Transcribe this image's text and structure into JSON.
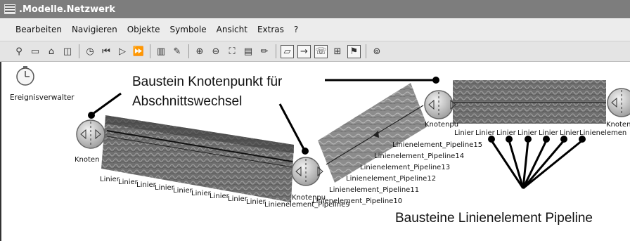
{
  "window": {
    "title": ".Modelle.Netzwerk"
  },
  "menu": [
    "Bearbeiten",
    "Navigieren",
    "Objekte",
    "Symbole",
    "Ansicht",
    "Extras",
    "?"
  ],
  "toolbar": {
    "icons": [
      "binoculars-icon",
      "up-folder-icon",
      "home-icon",
      "3d-view-icon",
      "stopwatch-icon",
      "skip-start-icon",
      "play-icon",
      "fast-forward-icon",
      "delete-icon",
      "sweep-icon",
      "zoom-in-icon",
      "zoom-out-icon",
      "fit-view-icon",
      "page-icon",
      "pencil-icon",
      "edit-tool-icon",
      "connector-icon",
      "comment-icon",
      "grid-icon",
      "animation-icon",
      "help-icon"
    ]
  },
  "diagram": {
    "event_manager_label": "Ereignisverwalter",
    "callout_node": [
      "Baustein Knotenpunkt für",
      "Abschnittswechsel"
    ],
    "callout_lines": "Bausteine Linienelement Pipeline",
    "node_labels": {
      "left": "Knoten",
      "middle": "Knotenpu",
      "upper": "Knotenpu",
      "right": "Knoten"
    },
    "left_segment_labels": [
      "Linier",
      "Linier",
      "Linier",
      "Linier",
      "Linier",
      "Linier",
      "Linier",
      "Linier",
      "Linier",
      "Linier",
      "Linier",
      "Linier",
      "Linienelement_Pipeline9"
    ],
    "middle_segment_labels": [
      "Linienelement_Pipeline10",
      "Linienelement_Pipeline11",
      "Linienelement_Pipeline12",
      "Linienelement_Pipeline13",
      "Linienelement_Pipeline14",
      "Linienelement_Pipeline15"
    ],
    "right_segment_labels": [
      "Linier",
      "Linier",
      "Linier",
      "Linier",
      "Linier",
      "Linier",
      "Linienelemen"
    ]
  }
}
